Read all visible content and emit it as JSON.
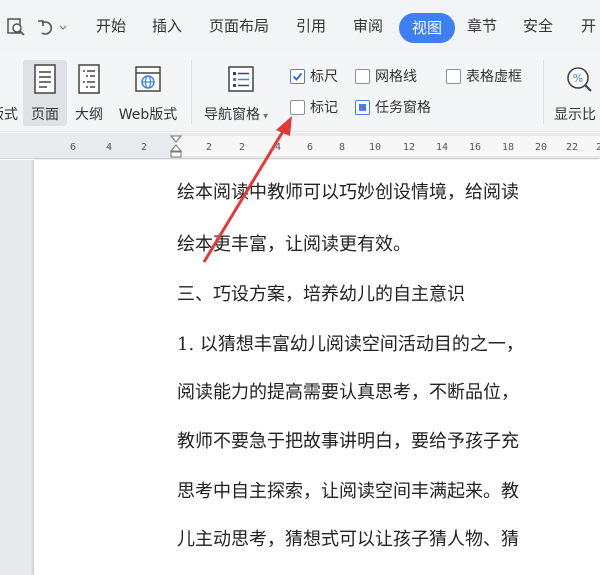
{
  "menubar": {
    "items": [
      "开始",
      "插入",
      "页面布局",
      "引用",
      "审阅",
      "视图",
      "章节",
      "安全",
      "开"
    ],
    "active": "视图"
  },
  "ribbon": {
    "view_buttons": {
      "partial": "版式",
      "page": "页面",
      "outline": "大纲",
      "web": "Web版式"
    },
    "nav_pane": "导航窗格",
    "checkboxes": {
      "ruler": "标尺",
      "gridlines": "网格线",
      "table_gridlines": "表格虚框",
      "markup": "标记",
      "task_pane": "任务窗格"
    },
    "zoom": "显示比"
  },
  "ruler": {
    "ticks": [
      "6",
      "4",
      "2",
      "2",
      "2",
      "4",
      "6",
      "8",
      "10",
      "12",
      "14",
      "16",
      "18",
      "20",
      "22",
      "24"
    ]
  },
  "document": {
    "lines": [
      "绘本阅读中教师可以巧妙创设情境，给阅读",
      "绘本更丰富，让阅读更有效。",
      "三、巧设方案，培养幼儿的自主意识",
      "1. 以猜想丰富幼儿阅读空间活动目的之一，",
      "阅读能力的提高需要认真思考，不断品位，",
      "教师不要急于把故事讲明白，要给予孩子充",
      "思考中自主探索，让阅读空间丰满起来。教",
      "儿主动思考，猜想式可以让孩子猜人物、猜"
    ]
  },
  "colors": {
    "accent": "#3f7ff5",
    "annotation_arrow": "#e53935"
  }
}
